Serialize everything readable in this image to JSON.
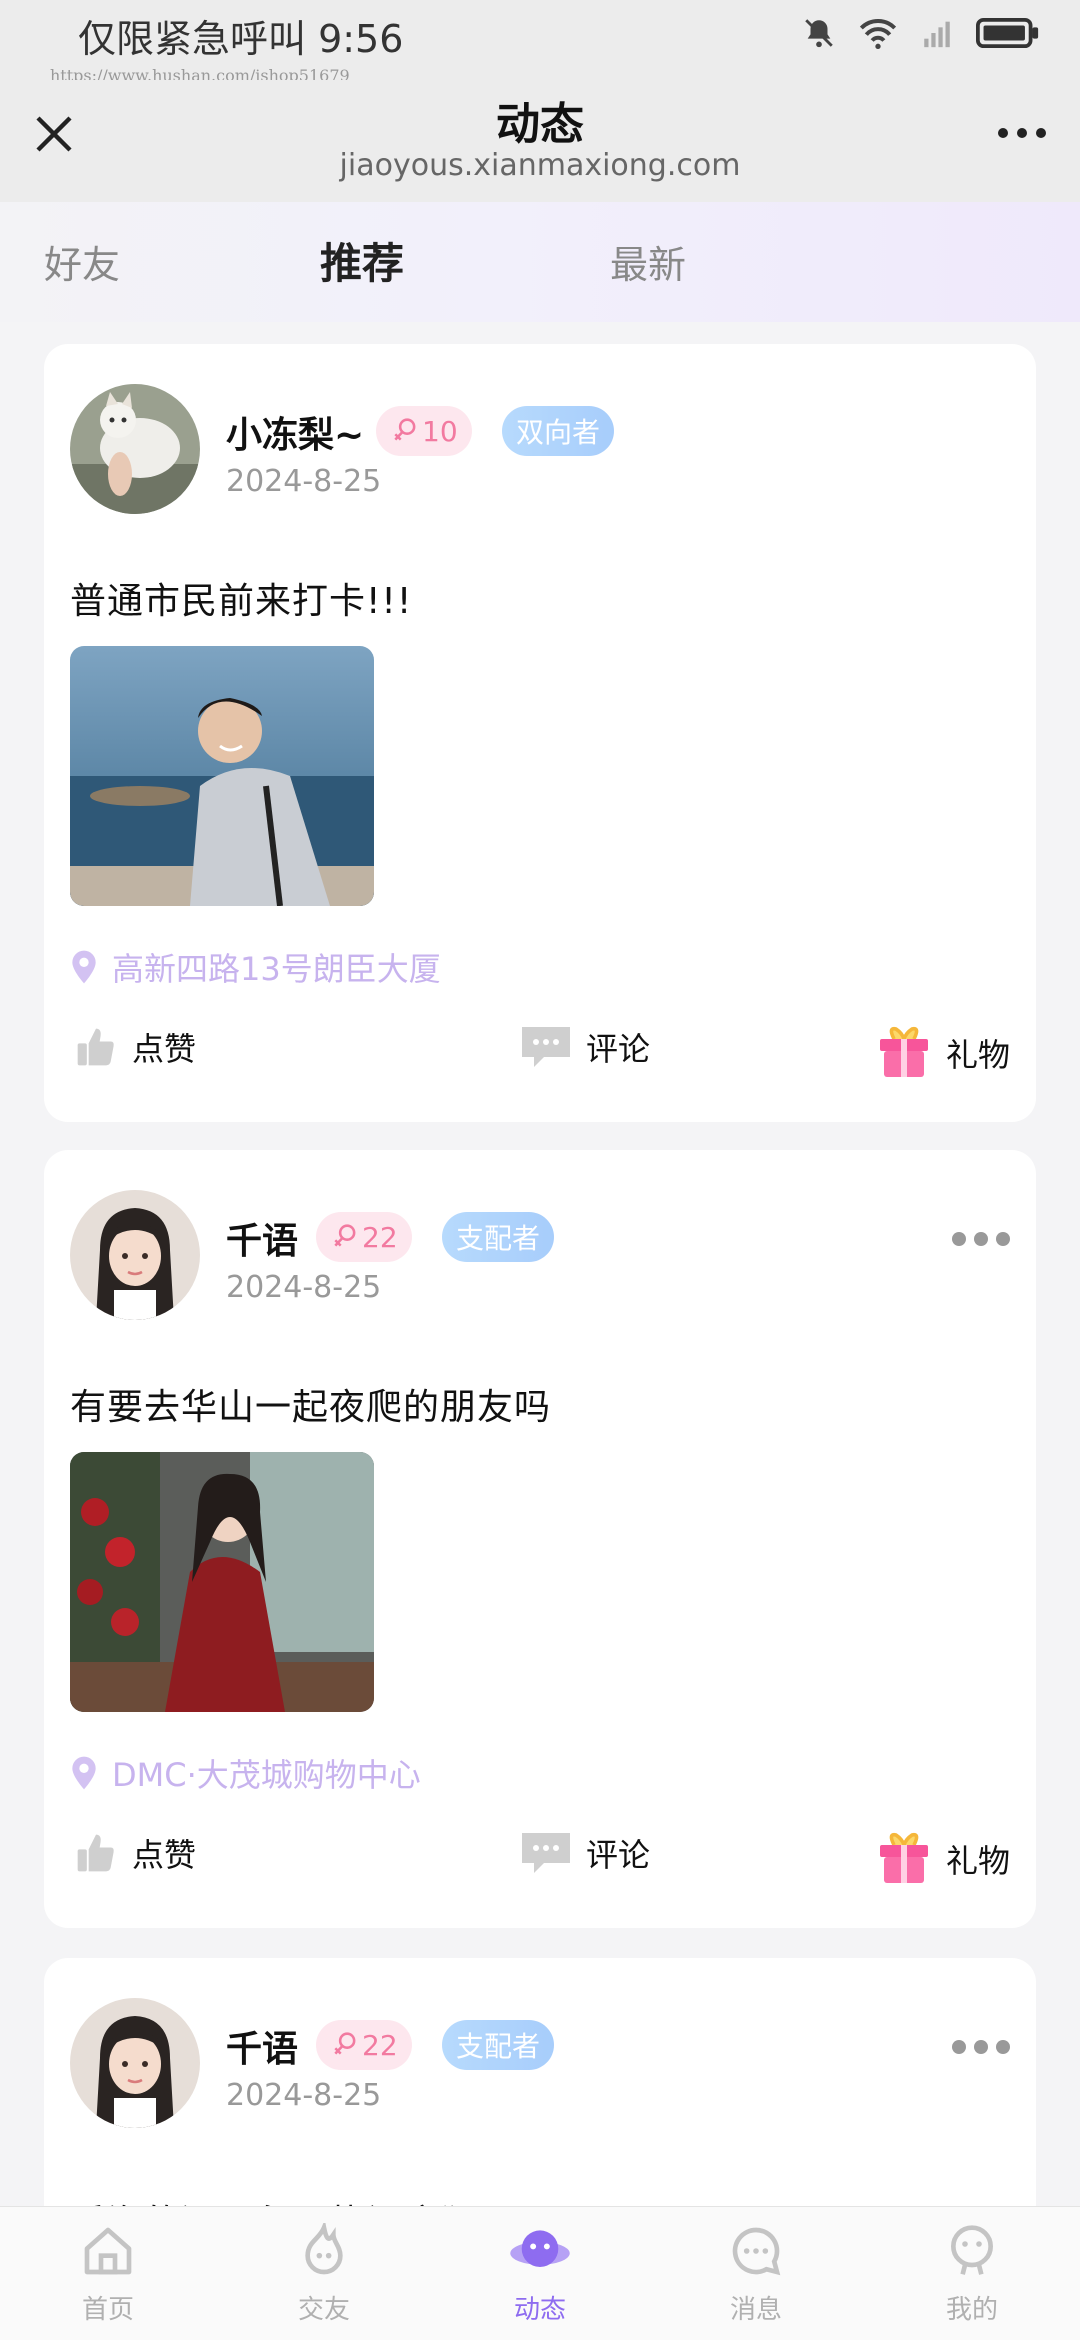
{
  "status_bar": {
    "text": "仅限紧急呼叫 9:56",
    "watermark_url": "https://www.hushan.com/ishop51679"
  },
  "nav": {
    "title": "动态",
    "subtitle": "jiaoyous.xianmaxiong.com"
  },
  "tabs": [
    {
      "label": "好友",
      "active": false
    },
    {
      "label": "推荐",
      "active": true
    },
    {
      "label": "最新",
      "active": false
    }
  ],
  "posts": [
    {
      "username": "小冻梨~",
      "level": "10",
      "role": "双向者",
      "date": "2024-8-25",
      "content": "普通市民前来打卡!!!",
      "location": "高新四路13号朗臣大厦",
      "actions": {
        "like": "点赞",
        "comment": "评论",
        "gift": "礼物"
      }
    },
    {
      "username": "千语",
      "level": "22",
      "role": "支配者",
      "date": "2024-8-25",
      "content": "有要去华山一起夜爬的朋友吗",
      "location": "DMC·大茂城购物中心",
      "actions": {
        "like": "点赞",
        "comment": "评论",
        "gift": "礼物"
      }
    },
    {
      "username": "千语",
      "level": "22",
      "role": "支配者",
      "date": "2024-8-25",
      "content": "后海的酒吧永远热闹疯狂"
    }
  ],
  "bottom_nav": [
    {
      "label": "首页",
      "icon": "home-icon",
      "active": false
    },
    {
      "label": "交友",
      "icon": "flame-icon",
      "active": false
    },
    {
      "label": "动态",
      "icon": "planet-icon",
      "active": true
    },
    {
      "label": "消息",
      "icon": "message-icon",
      "active": false
    },
    {
      "label": "我的",
      "icon": "profile-icon",
      "active": false
    }
  ],
  "colors": {
    "accent": "#8e6cf0",
    "level_bg": "#fde7ee",
    "level_text": "#f27aa0",
    "location_text": "#c7b3ee"
  }
}
